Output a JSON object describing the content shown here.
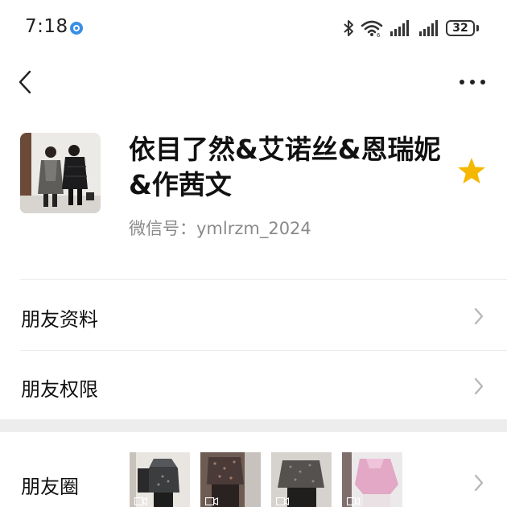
{
  "status_bar": {
    "time": "7:18",
    "battery": "32",
    "icons": [
      "messenger-icon",
      "bluetooth-icon",
      "wifi-icon",
      "signal-icon",
      "signal-icon",
      "battery-icon"
    ]
  },
  "nav": {
    "back_icon": "chevron-left-icon",
    "more_icon": "more-dots-icon"
  },
  "profile": {
    "name": "依目了然&艾诺丝&恩瑞妮&作茜文",
    "wechat_id": "微信号：ymlrzm_2024",
    "star_color": "#f5b800"
  },
  "menu": {
    "items": [
      {
        "label": "朋友资料"
      },
      {
        "label": "朋友权限"
      },
      {
        "label": "朋友圈"
      }
    ]
  },
  "colors": {
    "divider": "#ececec",
    "section_gap": "#ededed",
    "secondary_text": "#8a8a8a"
  }
}
